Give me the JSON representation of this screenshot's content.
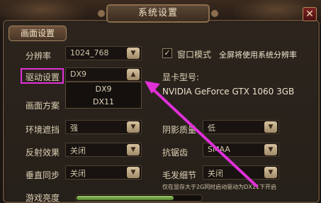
{
  "window": {
    "title": "系统设置",
    "close_glyph": "✕"
  },
  "tab": {
    "label": "画面设置"
  },
  "resolution": {
    "label": "分辨率",
    "value": "1024_768"
  },
  "driver": {
    "label": "驱动设置",
    "value": "DX9",
    "options": [
      "DX9",
      "DX11"
    ]
  },
  "quality_preset": {
    "label": "画面方案"
  },
  "ambient_occlusion": {
    "label": "环境遮挡",
    "value": "强"
  },
  "reflection": {
    "label": "反射效果",
    "value": "关闭"
  },
  "vsync": {
    "label": "垂直同步",
    "value": "关闭"
  },
  "brightness": {
    "label": "游戏亮度",
    "level": 0.78
  },
  "window_mode": {
    "checkbox_glyph": "✓",
    "label": "窗口模式",
    "hint": "全屏将使用系统分辨率",
    "checked": true
  },
  "gpu": {
    "label": "显卡型号:",
    "value": "NVIDIA GeForce GTX 1060 3GB"
  },
  "shadow_quality": {
    "label": "阴影质量",
    "value": "低"
  },
  "anti_aliasing": {
    "label": "抗锯齿",
    "value": "SMAA"
  },
  "hair_detail": {
    "label": "毛发细节",
    "value": "关闭",
    "note": "仅在显存大于2G同时启动驱动为DX11下开启"
  },
  "icons": {
    "dropdown": "chevron-down-icon",
    "dropdown_open": "chevron-up-icon",
    "close": "close-icon"
  },
  "colors": {
    "highlight": "#e030d8",
    "frame": "#5a4632",
    "arrow": "#e030d8"
  }
}
